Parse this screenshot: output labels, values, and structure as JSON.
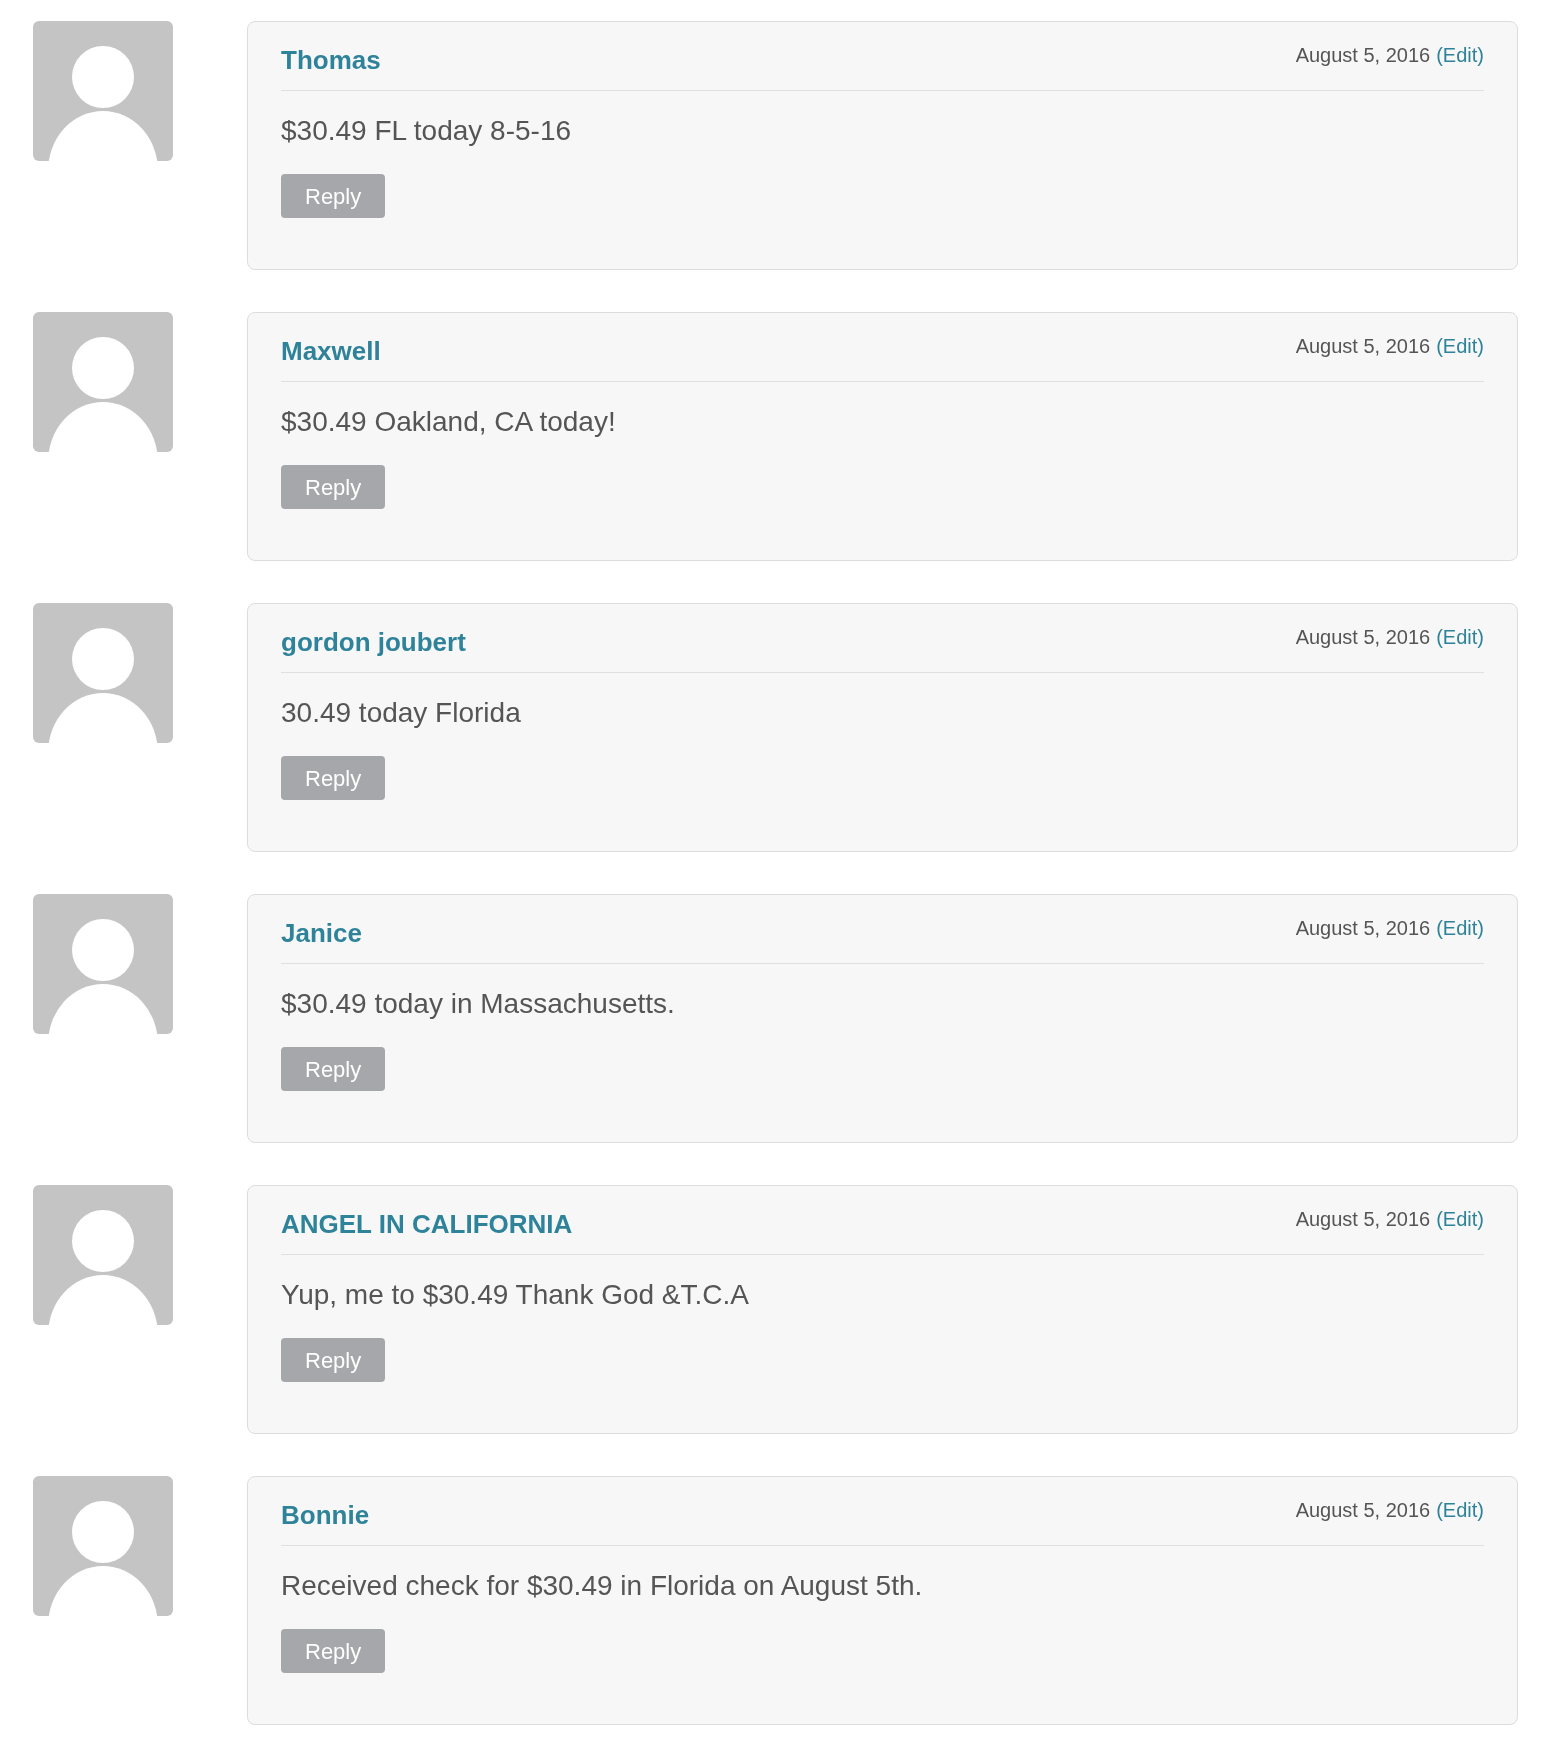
{
  "comments": [
    {
      "author": "Thomas",
      "date": "August 5, 2016",
      "edit": "(Edit)",
      "text": "$30.49 FL today 8-5-16",
      "reply": "Reply"
    },
    {
      "author": "Maxwell",
      "date": "August 5, 2016",
      "edit": "(Edit)",
      "text": "$30.49 Oakland, CA today!",
      "reply": "Reply"
    },
    {
      "author": "gordon joubert",
      "date": "August 5, 2016",
      "edit": "(Edit)",
      "text": "30.49 today Florida",
      "reply": "Reply"
    },
    {
      "author": "Janice",
      "date": "August 5, 2016",
      "edit": "(Edit)",
      "text": "$30.49 today in Massachusetts.",
      "reply": "Reply"
    },
    {
      "author": "ANGEL IN CALIFORNIA",
      "date": "August 5, 2016",
      "edit": "(Edit)",
      "text": "Yup, me to $30.49 Thank God &T.C.A",
      "reply": "Reply"
    },
    {
      "author": "Bonnie",
      "date": "August 5, 2016",
      "edit": "(Edit)",
      "text": "Received check for $30.49 in Florida on August 5th.",
      "reply": "Reply"
    }
  ]
}
